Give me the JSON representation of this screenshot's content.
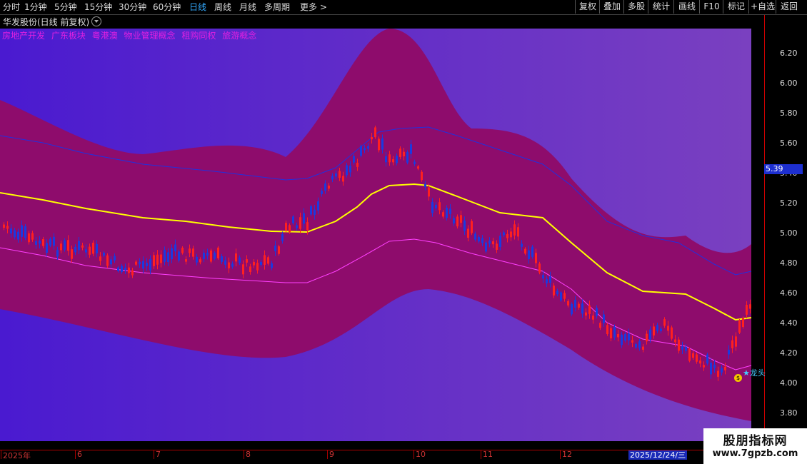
{
  "toolbar": {
    "periods": [
      {
        "label": "分时"
      },
      {
        "label": "1分钟"
      },
      {
        "label": "5分钟"
      },
      {
        "label": "15分钟"
      },
      {
        "label": "30分钟"
      },
      {
        "label": "60分钟"
      },
      {
        "label": "日线"
      },
      {
        "label": "周线"
      },
      {
        "label": "月线"
      },
      {
        "label": "多周期"
      },
      {
        "label": "更多 >"
      }
    ],
    "active_period": "日线",
    "actions": [
      {
        "label": "复权"
      },
      {
        "label": "叠加"
      },
      {
        "label": "多股"
      },
      {
        "label": "统计"
      },
      {
        "label": "画线"
      },
      {
        "label": "F10"
      },
      {
        "label": "标记"
      },
      {
        "label": "+自选"
      },
      {
        "label": "返回"
      }
    ]
  },
  "title": "华发股份(日线 前复权)",
  "concepts": [
    "房地产开发",
    "广东板块",
    "粤港澳",
    "物业管理概念",
    "租购同权",
    "旅游概念"
  ],
  "axis": {
    "ticks": [
      "6.20",
      "6.00",
      "5.80",
      "5.60",
      "5.40",
      "5.20",
      "5.00",
      "4.80",
      "4.60",
      "4.40",
      "4.20",
      "4.00",
      "3.80"
    ],
    "current_price": "5.39"
  },
  "dates": {
    "labels": [
      "2025年",
      "6",
      "7",
      "8",
      "9",
      "10",
      "11",
      "12"
    ],
    "cursor": "2025/12/24/三"
  },
  "marker": {
    "label": "★龙头",
    "coin": "$"
  },
  "watermark": {
    "line1": "股朋指标网",
    "line2": "www.7gpzb.com"
  },
  "colors": {
    "bg_left": "#4a1ad0",
    "bg_right": "#7a40c0",
    "band": "#8e0c6c",
    "mid_line": "#ffff00",
    "upper_line": "#2030e0",
    "lower_line": "#ff40ff",
    "up": "#ff2020",
    "down": "#1a3ae0"
  }
}
